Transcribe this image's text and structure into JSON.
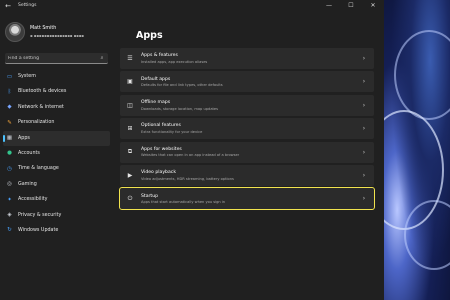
{
  "window": {
    "app_title": "Settings",
    "back_icon": "back-arrow-icon",
    "caption_buttons": [
      "—",
      "☐",
      "✕"
    ]
  },
  "profile": {
    "name": "Matt Smith",
    "email": "▪ ▪▪▪▪▪▪▪▪▪▪▪▪▪▪▪ ▪▪▪▪"
  },
  "search": {
    "placeholder": "Find a setting"
  },
  "nav": {
    "accent_color": "#4cc2ff",
    "active_index": 6,
    "items": [
      {
        "label": "System",
        "icon": "monitor-icon",
        "color": "#4aa3ff"
      },
      {
        "label": "Bluetooth & devices",
        "icon": "bluetooth-icon",
        "color": "#4aa3ff"
      },
      {
        "label": "Network & internet",
        "icon": "wifi-icon",
        "color": "#7aa6ff"
      },
      {
        "label": "Personalization",
        "icon": "brush-icon",
        "color": "#f0a23a"
      },
      {
        "label": "Apps",
        "icon": "apps-icon",
        "color": "#cfd4dc"
      },
      {
        "label": "Accounts",
        "icon": "person-icon",
        "color": "#33c48d"
      },
      {
        "label": "Time & language",
        "icon": "globe-clock-icon",
        "color": "#4aa3ff"
      },
      {
        "label": "Gaming",
        "icon": "gamepad-icon",
        "color": "#cfd4dc"
      },
      {
        "label": "Accessibility",
        "icon": "accessibility-icon",
        "color": "#4aa3ff"
      },
      {
        "label": "Privacy & security",
        "icon": "shield-icon",
        "color": "#cfd4dc"
      },
      {
        "label": "Windows Update",
        "icon": "update-icon",
        "color": "#4aa3ff"
      }
    ]
  },
  "main": {
    "title": "Apps",
    "highlight_color": "#f1e34e",
    "cards": [
      {
        "title": "Apps & features",
        "desc": "Installed apps, app execution aliases",
        "icon": "list-icon",
        "glyph": "☰",
        "highlighted": false
      },
      {
        "title": "Default apps",
        "desc": "Defaults for file and link types, other defaults",
        "icon": "default-apps-icon",
        "glyph": "▣",
        "highlighted": false
      },
      {
        "title": "Offline maps",
        "desc": "Downloads, storage location, map updates",
        "icon": "map-icon",
        "glyph": "◫",
        "highlighted": false
      },
      {
        "title": "Optional features",
        "desc": "Extra functionality for your device",
        "icon": "optional-features-icon",
        "glyph": "⊞",
        "highlighted": false
      },
      {
        "title": "Apps for websites",
        "desc": "Websites that can open in an app instead of a browser",
        "icon": "web-app-icon",
        "glyph": "⧉",
        "highlighted": false
      },
      {
        "title": "Video playback",
        "desc": "Video adjustments, HDR streaming, battery options",
        "icon": "video-icon",
        "glyph": "▶",
        "highlighted": false
      },
      {
        "title": "Startup",
        "desc": "Apps that start automatically when you sign in",
        "icon": "startup-icon",
        "glyph": "⏻",
        "highlighted": true
      }
    ]
  }
}
